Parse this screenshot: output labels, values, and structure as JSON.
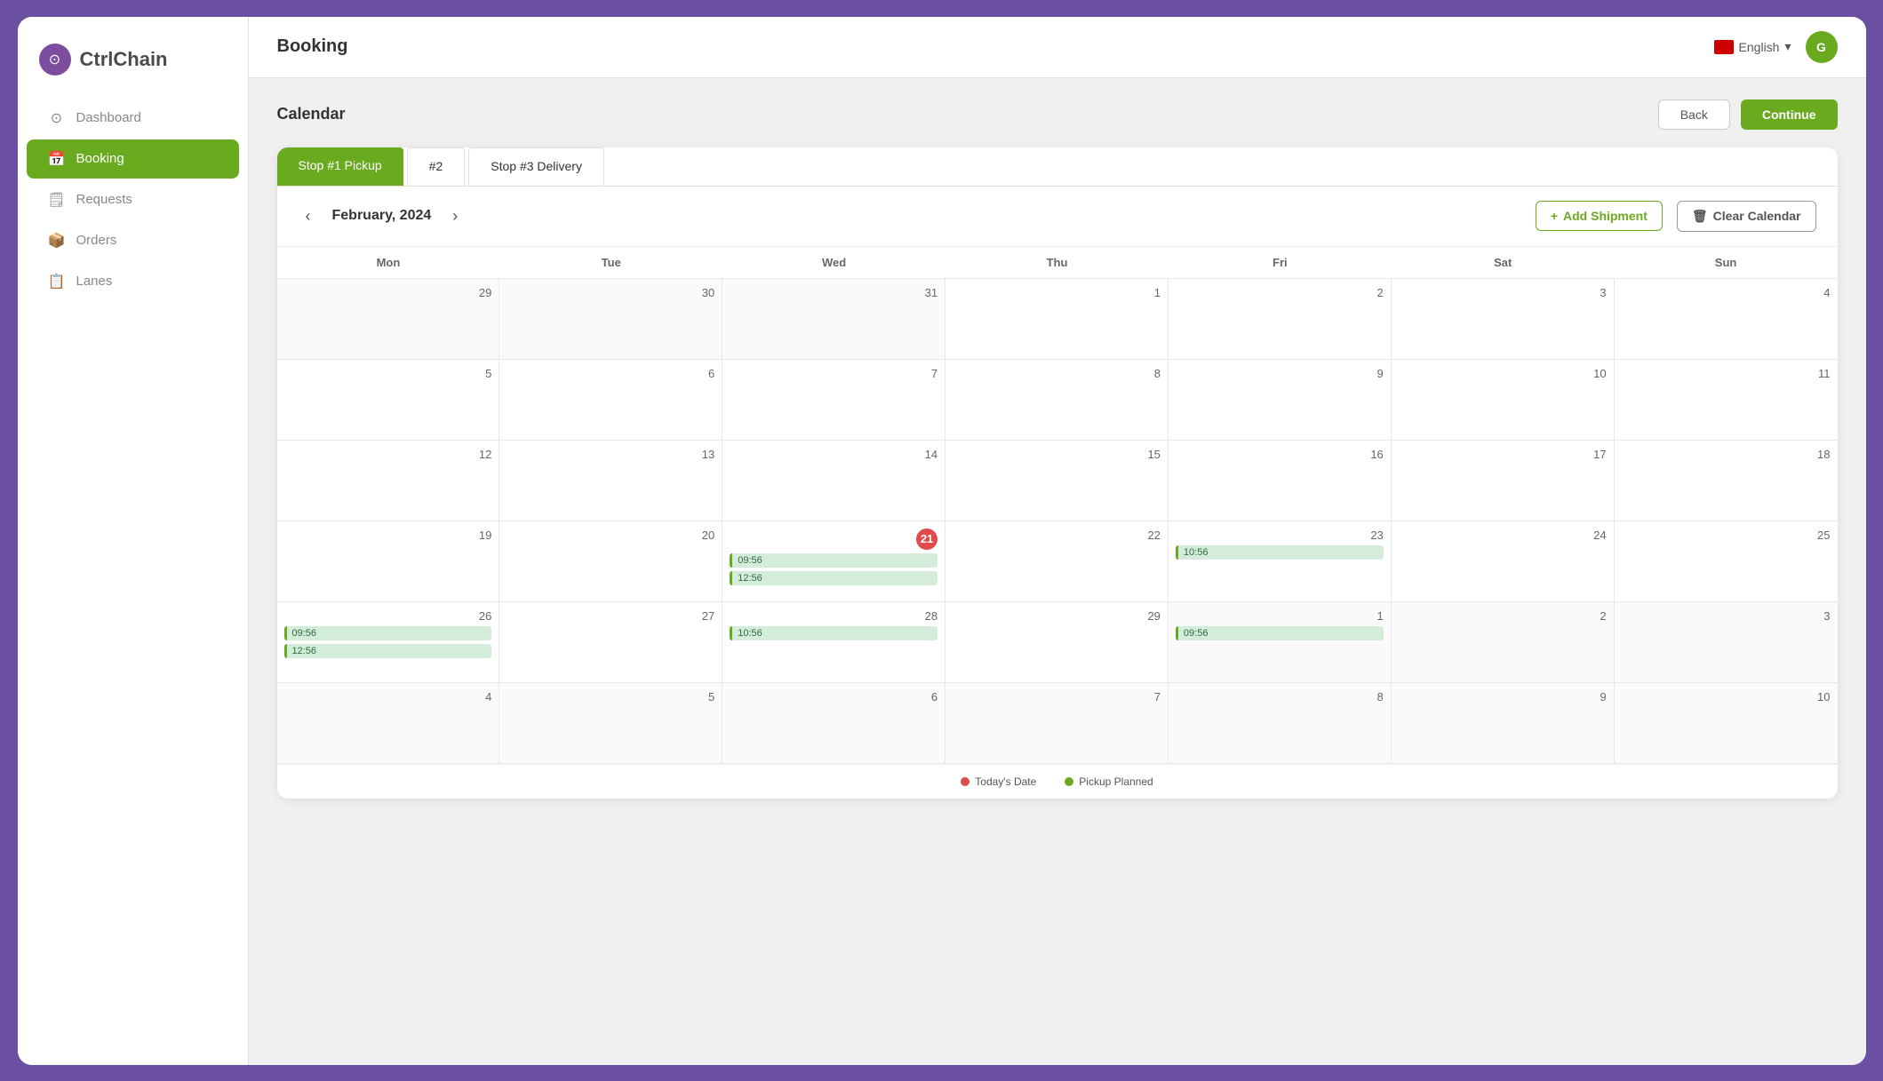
{
  "app": {
    "name": "CtrlChain"
  },
  "sidebar": {
    "items": [
      {
        "id": "dashboard",
        "label": "Dashboard",
        "icon": "⊙",
        "active": false
      },
      {
        "id": "booking",
        "label": "Booking",
        "icon": "📅",
        "active": true
      },
      {
        "id": "requests",
        "label": "Requests",
        "icon": "🗒",
        "active": false
      },
      {
        "id": "orders",
        "label": "Orders",
        "icon": "📦",
        "active": false
      },
      {
        "id": "lanes",
        "label": "Lanes",
        "icon": "📋",
        "active": false
      }
    ]
  },
  "topbar": {
    "page_title": "Booking",
    "lang": "English",
    "user_initials": "G"
  },
  "content": {
    "section_title": "Calendar",
    "back_label": "Back",
    "continue_label": "Continue"
  },
  "tabs": [
    {
      "id": "stop1",
      "label": "Stop  #1  Pickup",
      "active": true
    },
    {
      "id": "stop2",
      "label": "#2",
      "active": false
    },
    {
      "id": "stop3",
      "label": "Stop  #3  Delivery",
      "active": false
    }
  ],
  "calendar": {
    "month": "February, 2024",
    "add_shipment_label": "Add Shipment",
    "clear_calendar_label": "Clear Calendar",
    "day_names": [
      "Mon",
      "Tue",
      "Wed",
      "Thu",
      "Fri",
      "Sat",
      "Sun"
    ],
    "weeks": [
      [
        {
          "date": "29",
          "other": true,
          "events": []
        },
        {
          "date": "30",
          "other": true,
          "events": []
        },
        {
          "date": "31",
          "other": true,
          "events": []
        },
        {
          "date": "1",
          "events": []
        },
        {
          "date": "2",
          "events": []
        },
        {
          "date": "3",
          "events": []
        },
        {
          "date": "4",
          "events": []
        }
      ],
      [
        {
          "date": "5",
          "events": []
        },
        {
          "date": "6",
          "events": []
        },
        {
          "date": "7",
          "events": []
        },
        {
          "date": "8",
          "events": []
        },
        {
          "date": "9",
          "events": []
        },
        {
          "date": "10",
          "events": []
        },
        {
          "date": "11",
          "events": []
        }
      ],
      [
        {
          "date": "12",
          "events": []
        },
        {
          "date": "13",
          "events": []
        },
        {
          "date": "14",
          "events": []
        },
        {
          "date": "15",
          "events": []
        },
        {
          "date": "16",
          "events": []
        },
        {
          "date": "17",
          "events": []
        },
        {
          "date": "18",
          "events": []
        }
      ],
      [
        {
          "date": "19",
          "events": []
        },
        {
          "date": "20",
          "events": []
        },
        {
          "date": "21",
          "today": true,
          "events": [
            {
              "time": "09:56"
            },
            {
              "time": "12:56"
            }
          ]
        },
        {
          "date": "22",
          "events": []
        },
        {
          "date": "23",
          "events": [
            {
              "time": "10:56"
            }
          ]
        },
        {
          "date": "24",
          "events": []
        },
        {
          "date": "25",
          "events": []
        }
      ],
      [
        {
          "date": "26",
          "events": [
            {
              "time": "09:56"
            },
            {
              "time": "12:56"
            }
          ]
        },
        {
          "date": "27",
          "events": []
        },
        {
          "date": "28",
          "events": [
            {
              "time": "10:56"
            }
          ]
        },
        {
          "date": "29",
          "events": []
        },
        {
          "date": "1",
          "other": true,
          "events": [
            {
              "time": "09:56"
            }
          ]
        },
        {
          "date": "2",
          "other": true,
          "events": []
        },
        {
          "date": "3",
          "other": true,
          "events": []
        }
      ],
      [
        {
          "date": "4",
          "other": true,
          "events": []
        },
        {
          "date": "5",
          "other": true,
          "events": []
        },
        {
          "date": "6",
          "other": true,
          "events": []
        },
        {
          "date": "7",
          "other": true,
          "events": []
        },
        {
          "date": "8",
          "other": true,
          "events": []
        },
        {
          "date": "9",
          "other": true,
          "events": []
        },
        {
          "date": "10",
          "other": true,
          "events": []
        }
      ]
    ],
    "legend": [
      {
        "label": "Today's Date",
        "color": "red"
      },
      {
        "label": "Pickup Planned",
        "color": "green"
      }
    ]
  }
}
